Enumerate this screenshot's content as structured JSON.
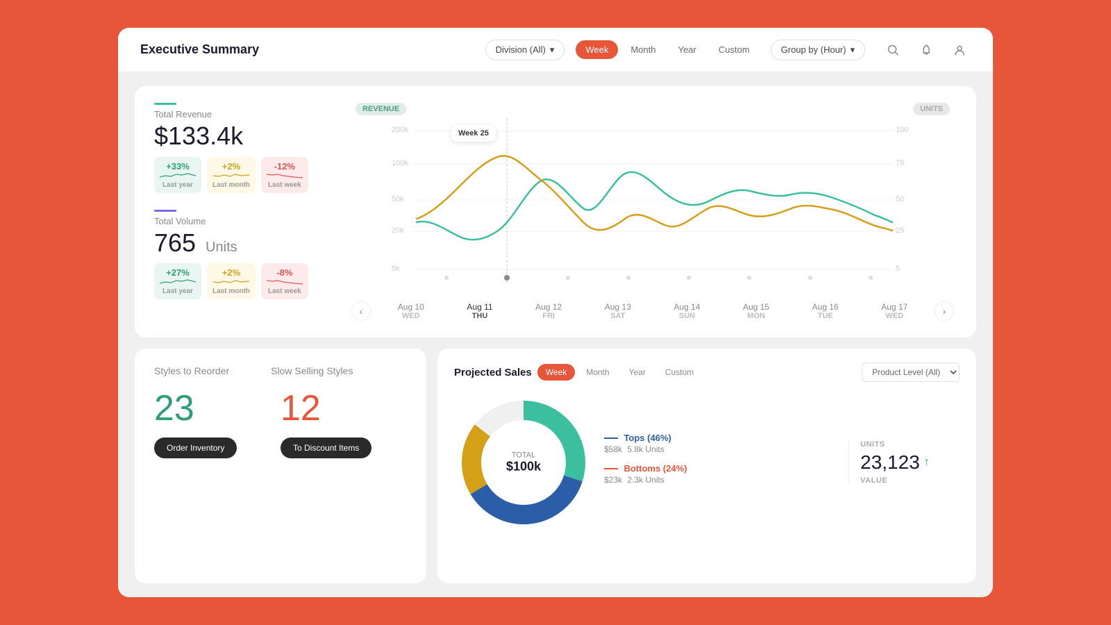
{
  "header": {
    "title": "Executive Summary",
    "division_label": "Division (All)",
    "time_filters": [
      "Week",
      "Month",
      "Year",
      "Custom"
    ],
    "active_time": "Week",
    "group_label": "Group by (Hour)",
    "search_icon": "🔍",
    "bell_icon": "🔔",
    "user_icon": "👤"
  },
  "revenue": {
    "accent_color": "#3bbf9e",
    "label": "Total Revenue",
    "value": "$133.4k",
    "badges": [
      {
        "type": "green",
        "value": "+33%",
        "sub": "Last year"
      },
      {
        "type": "yellow",
        "value": "+2%",
        "sub": "Last month"
      },
      {
        "type": "red",
        "value": "-12%",
        "sub": "Last week"
      }
    ]
  },
  "volume": {
    "accent_color": "#7b68ee",
    "label": "Total Volume",
    "value": "765",
    "unit": "Units",
    "badges": [
      {
        "type": "green",
        "value": "+27%",
        "sub": "Last year"
      },
      {
        "type": "yellow",
        "value": "+2%",
        "sub": "Last month"
      },
      {
        "type": "red",
        "value": "-8%",
        "sub": "Last week"
      }
    ]
  },
  "chart": {
    "revenue_tag": "REVENUE",
    "units_tag": "UNITS",
    "y_labels_left": [
      "200k",
      "100k",
      "50k",
      "20k",
      "5k"
    ],
    "y_labels_right": [
      "100",
      "75",
      "50",
      "25",
      "5"
    ],
    "tooltip": "Week 25",
    "dates": [
      {
        "date": "Aug 10",
        "day": "WED",
        "active": false
      },
      {
        "date": "Aug 11",
        "day": "THU",
        "active": true
      },
      {
        "date": "Aug 12",
        "day": "FRI",
        "active": false
      },
      {
        "date": "Aug 13",
        "day": "SAT",
        "active": false
      },
      {
        "date": "Aug 14",
        "day": "SUN",
        "active": false
      },
      {
        "date": "Aug 15",
        "day": "MON",
        "active": false
      },
      {
        "date": "Aug 16",
        "day": "TUE",
        "active": false
      },
      {
        "date": "Aug 17",
        "day": "WED",
        "active": false
      }
    ],
    "prev_btn": "‹",
    "next_btn": "›"
  },
  "styles_reorder": {
    "title": "Styles to Reorder",
    "value": "23",
    "btn_label": "Order Inventory"
  },
  "slow_selling": {
    "title": "Slow Selling Styles",
    "value": "12",
    "btn_label": "To Discount Items"
  },
  "projected_sales": {
    "title": "Projected Sales",
    "time_filters": [
      "Week",
      "Month",
      "Year",
      "Custom"
    ],
    "active_time": "Week",
    "product_select": "Product Level (All)",
    "donut_label": "TOTAL",
    "donut_value": "$100k",
    "legend": [
      {
        "color": "#2b5ea7",
        "name": "Tops (46%)",
        "value": "$58k",
        "units": "5.8k Units",
        "line_color": "#2b5ea7"
      },
      {
        "color": "#e8563a",
        "name": "Bottoms (24%)",
        "value": "$23k",
        "units": "2.3k Units",
        "line_color": "#e8563a"
      }
    ],
    "right_panel": {
      "units_label": "UNITS",
      "units_value": "23,123",
      "value_label": "VALUE"
    }
  }
}
